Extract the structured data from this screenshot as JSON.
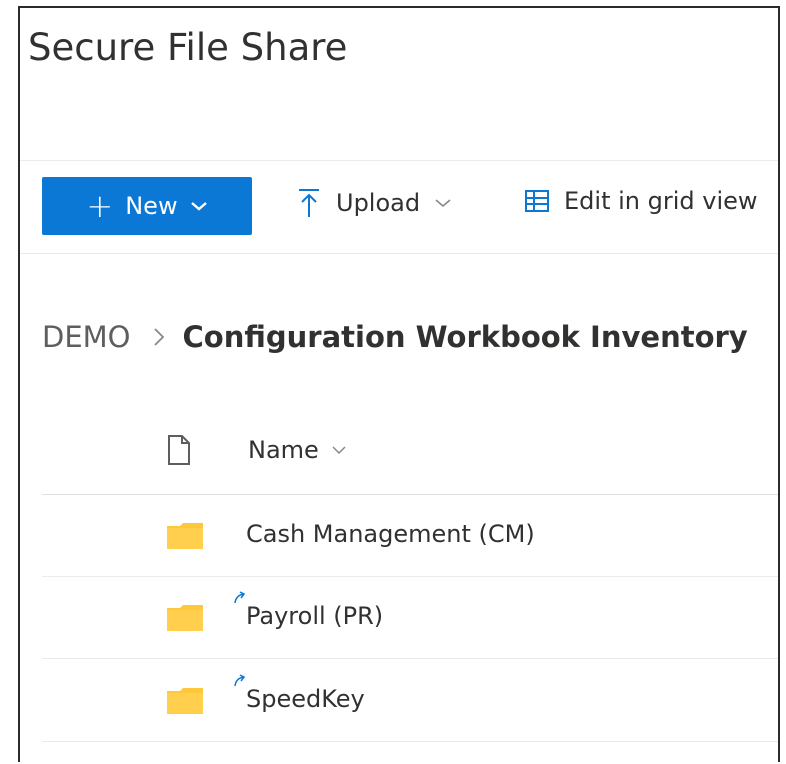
{
  "site": {
    "title": "Secure File Share"
  },
  "toolbar": {
    "new_label": "New",
    "upload_label": "Upload",
    "grid_label": "Edit in grid view"
  },
  "breadcrumb": {
    "root": "DEMO",
    "current": "Configuration Workbook Inventory"
  },
  "list": {
    "column_name": "Name",
    "rows": [
      {
        "name": "Cash Management (CM)",
        "icon": "folder-icon",
        "shortcut": false
      },
      {
        "name": "Payroll (PR)",
        "icon": "folder-icon",
        "shortcut": true
      },
      {
        "name": "SpeedKey",
        "icon": "folder-icon",
        "shortcut": true
      }
    ]
  },
  "colors": {
    "accent": "#0a78d4",
    "folder": "#ffc73a",
    "text": "#323130"
  }
}
